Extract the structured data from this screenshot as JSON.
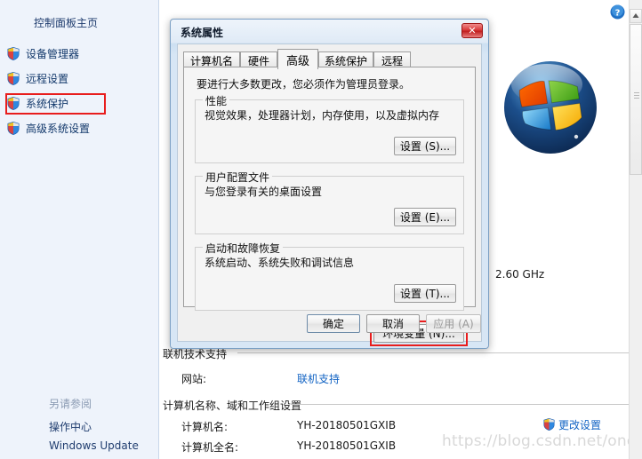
{
  "sidebar": {
    "home_label": "控制面板主页",
    "items": [
      {
        "label": "设备管理器",
        "icon": "shield-icon"
      },
      {
        "label": "远程设置",
        "icon": "shield-icon"
      },
      {
        "label": "系统保护",
        "icon": "shield-icon"
      },
      {
        "label": "高级系统设置",
        "icon": "shield-icon",
        "highlighted": true
      }
    ],
    "see_also_title": "另请参阅",
    "see_also_links": [
      {
        "label": "操作中心"
      },
      {
        "label": "Windows Update"
      }
    ]
  },
  "page": {
    "cpu_speed": "2.60 GHz",
    "support_section": "联机技术支持",
    "support_label": "网站:",
    "support_link": "联机支持",
    "computer_section": "计算机名称、域和工作组设置",
    "rows": [
      {
        "label": "计算机名:",
        "value": "YH-20180501GXIB"
      },
      {
        "label": "计算机全名:",
        "value": "YH-20180501GXIB"
      }
    ],
    "change_settings_link": "更改设置",
    "help_icon": "help-question-icon",
    "logo": "windows-logo",
    "watermark": "https://blog.csdn.net/one_bird_"
  },
  "dialog": {
    "title": "系统属性",
    "close_label": "✕",
    "tabs": [
      {
        "label": "计算机名",
        "active": false
      },
      {
        "label": "硬件",
        "active": false
      },
      {
        "label": "高级",
        "active": true
      },
      {
        "label": "系统保护",
        "active": false
      },
      {
        "label": "远程",
        "active": false
      }
    ],
    "admin_note": "要进行大多数更改，您必须作为管理员登录。",
    "groups": [
      {
        "legend": "性能",
        "description": "视觉效果，处理器计划，内存使用，以及虚拟内存",
        "button": "设置 (S)..."
      },
      {
        "legend": "用户配置文件",
        "description": "与您登录有关的桌面设置",
        "button": "设置 (E)..."
      },
      {
        "legend": "启动和故障恢复",
        "description": "系统启动、系统失败和调试信息",
        "button": "设置 (T)..."
      }
    ],
    "env_button": "环境变量 (N)...",
    "footer_buttons": [
      {
        "label": "确定",
        "enabled": true,
        "default": true
      },
      {
        "label": "取消",
        "enabled": true,
        "default": false
      },
      {
        "label": "应用 (A)",
        "enabled": false,
        "default": false
      }
    ]
  },
  "colors": {
    "highlight": "#e81d1d",
    "link": "#1364c4",
    "sidebar_bg": "#eef3fb"
  }
}
